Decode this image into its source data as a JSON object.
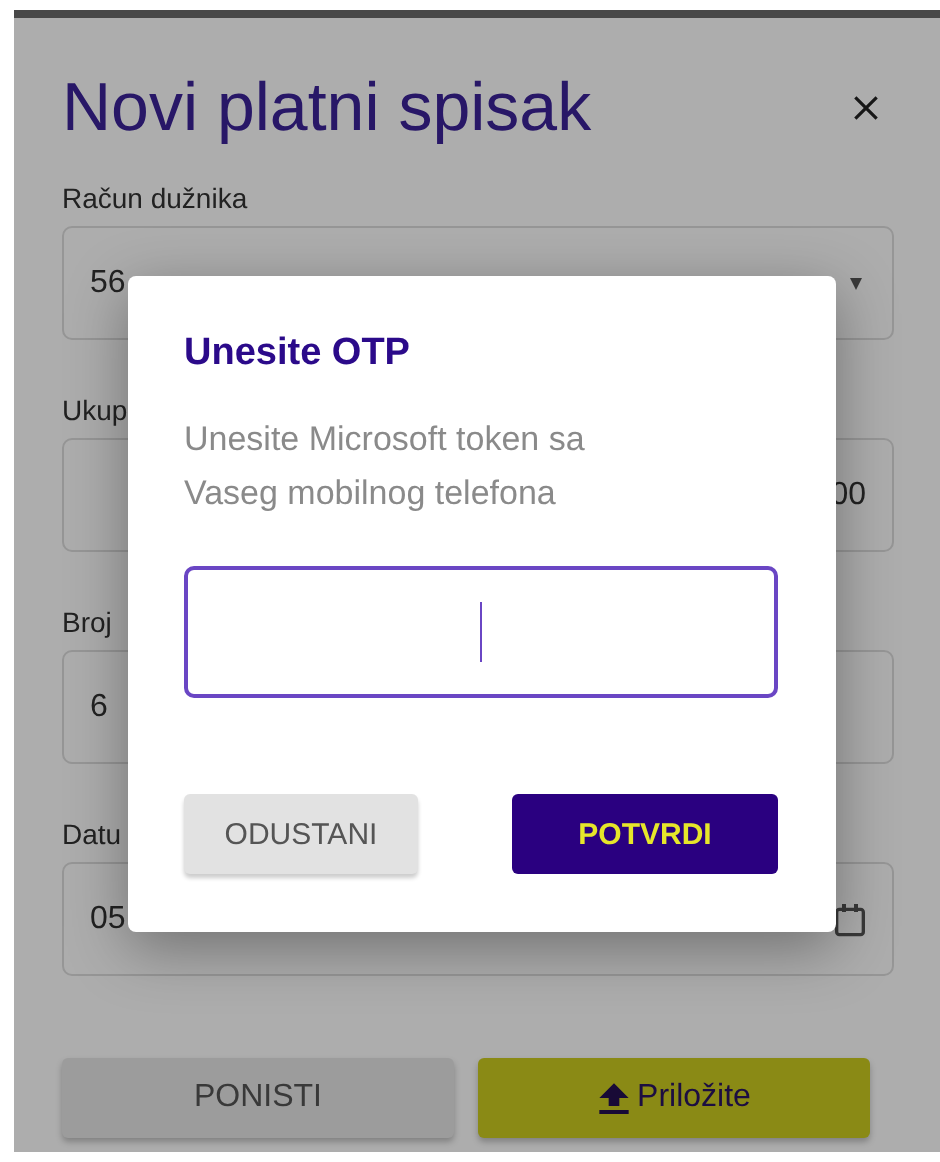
{
  "form": {
    "title": "Novi platni spisak",
    "fields": [
      {
        "kind": "select",
        "label": "Račun dužnika",
        "value": "56"
      },
      {
        "kind": "amount",
        "label": "Ukup",
        "value": "00"
      },
      {
        "kind": "text",
        "label": "Broj",
        "value": "6"
      },
      {
        "kind": "date",
        "label": "Datu",
        "value": "05"
      }
    ],
    "buttons": [
      {
        "label": "PONISTI",
        "kind": "secondary"
      },
      {
        "label": "Priložite",
        "kind": "upload"
      }
    ]
  },
  "dialog": {
    "title": "Unesite OTP",
    "message": "Unesite Microsoft token sa Vaseg mobilnog telefona",
    "input": {
      "focused": true
    },
    "buttons": [
      {
        "label": "ODUSTANI",
        "kind": "secondary"
      },
      {
        "label": "POTVRDI",
        "kind": "primary"
      }
    ]
  }
}
